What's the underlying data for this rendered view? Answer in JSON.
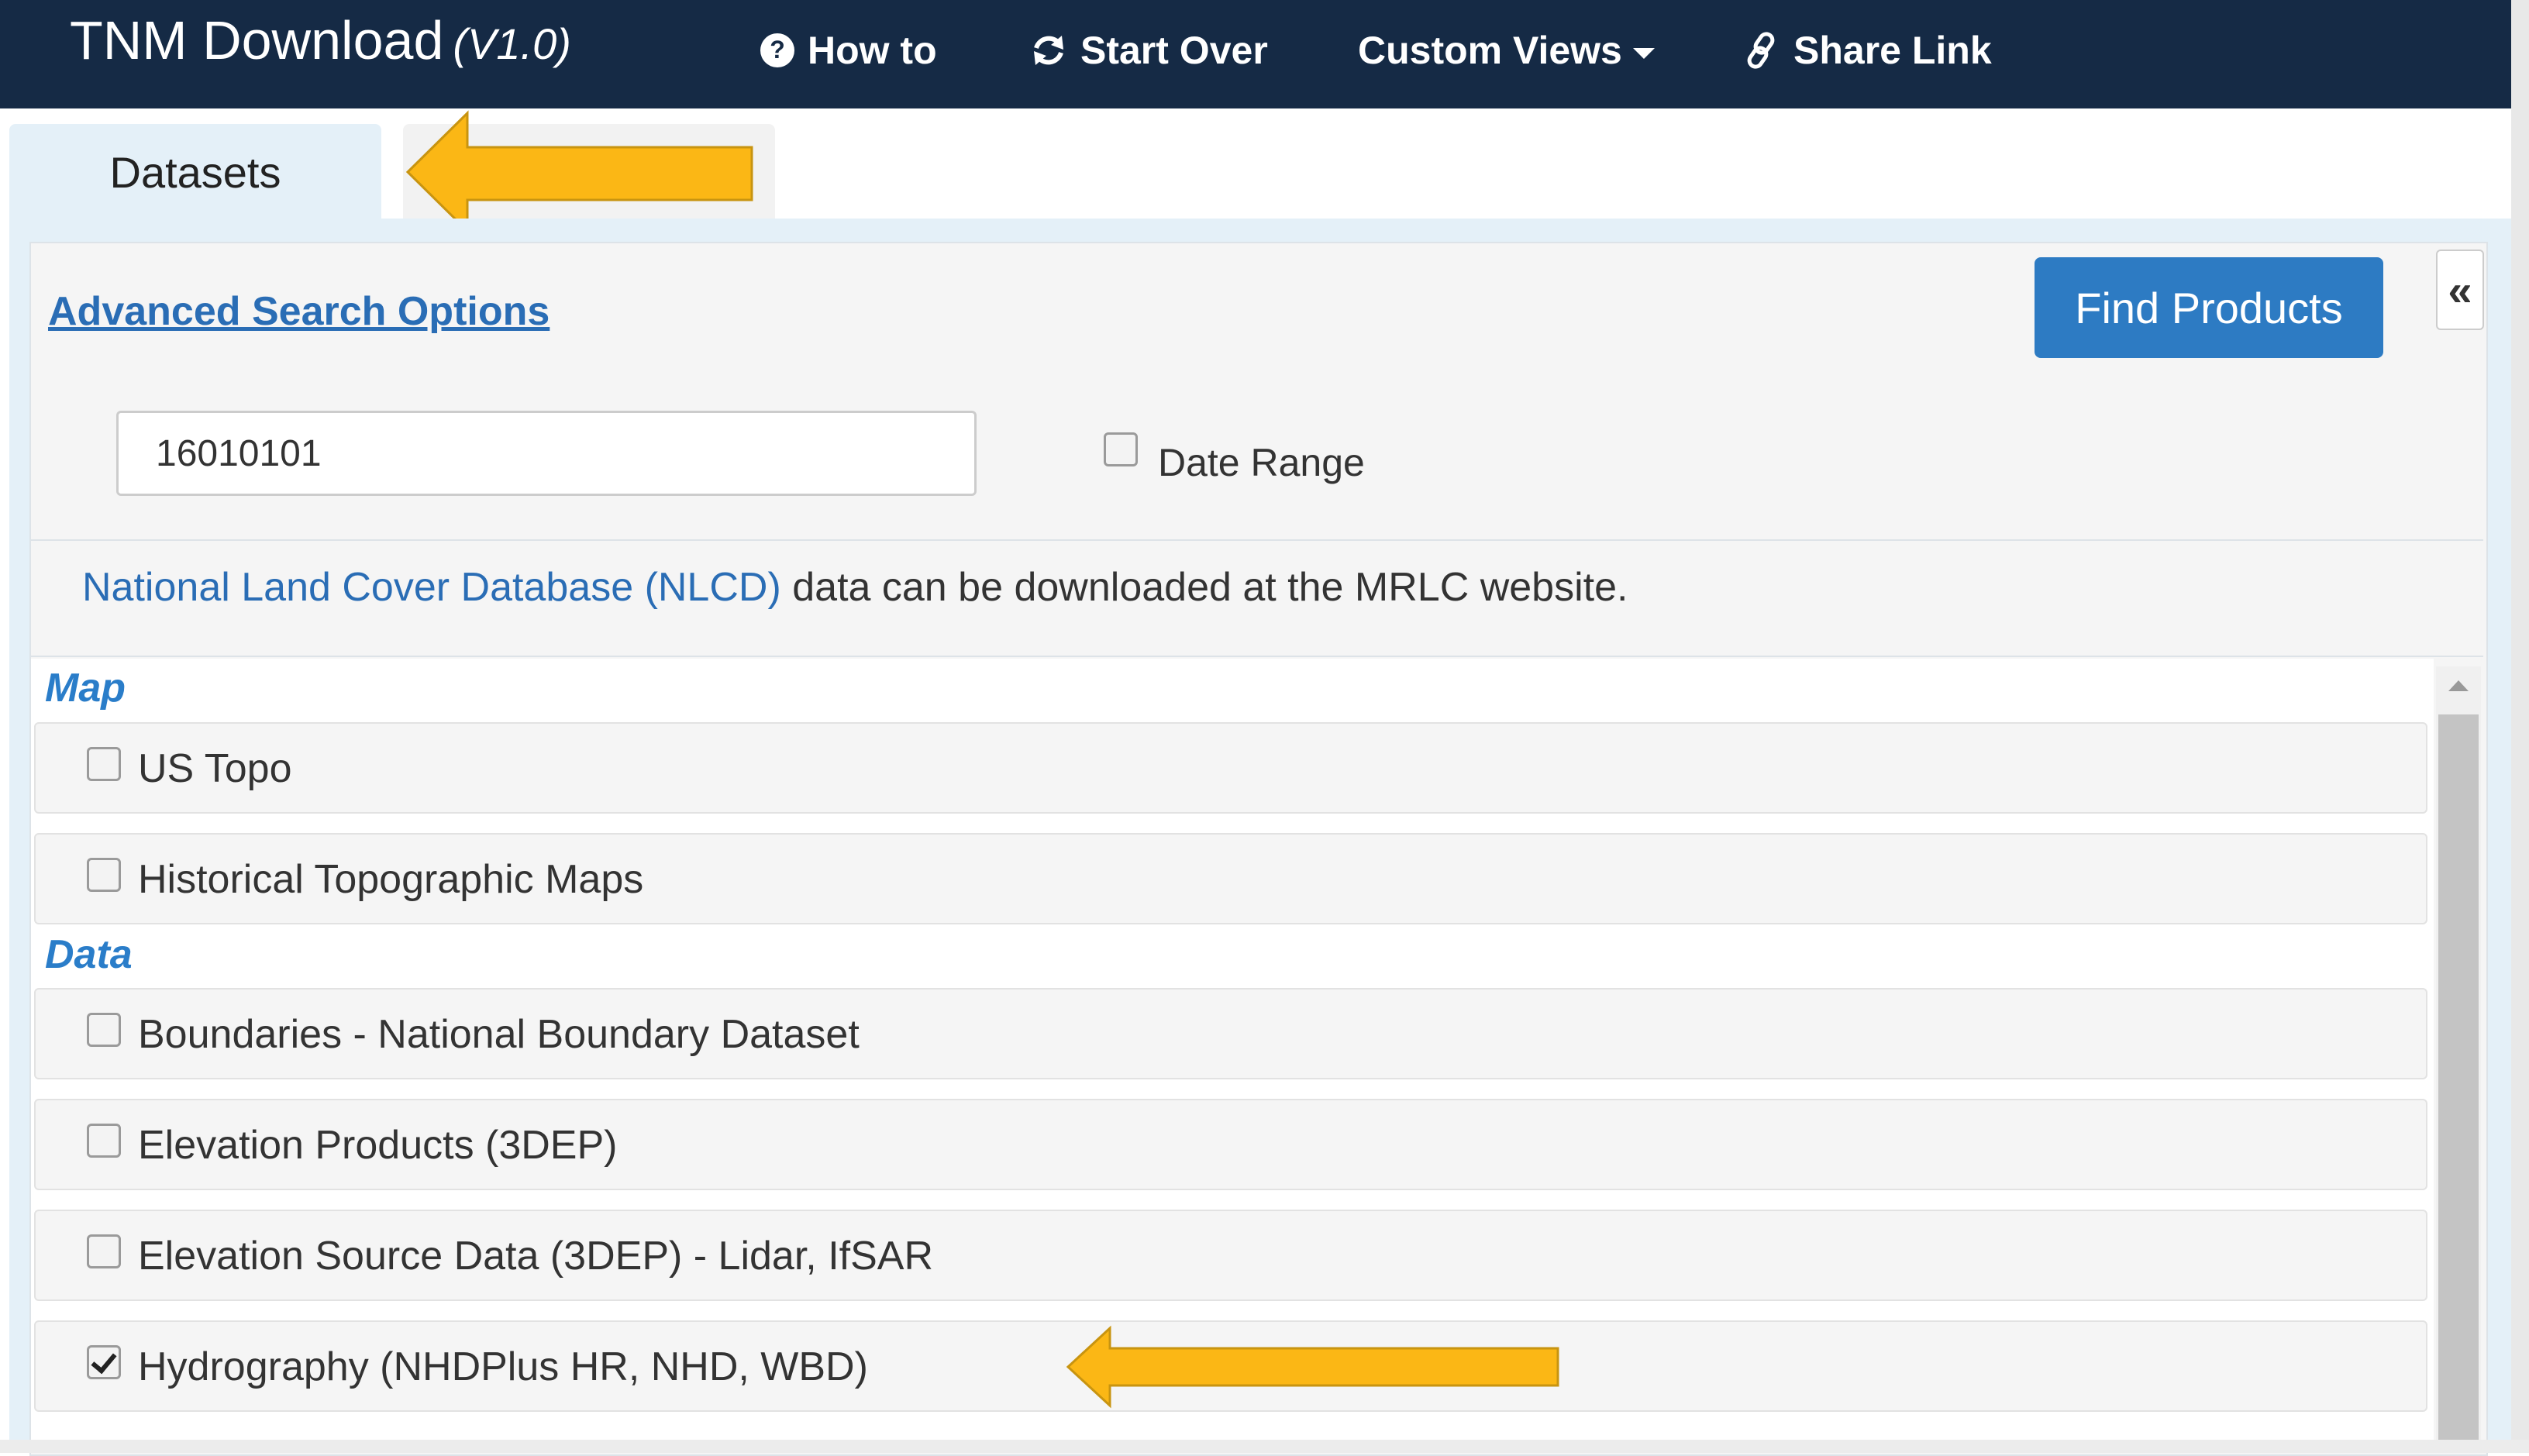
{
  "navbar": {
    "title": "TNM Download",
    "version": "(V1.0)",
    "items": [
      {
        "label": "How to",
        "icon": "question-circle-icon"
      },
      {
        "label": "Start Over",
        "icon": "refresh-icon"
      },
      {
        "label": "Custom Views",
        "icon": "chevron-down-icon"
      },
      {
        "label": "Share Link",
        "icon": "link-icon"
      }
    ]
  },
  "tabs": {
    "active_label": "Datasets"
  },
  "panel": {
    "advanced_link": "Advanced Search Options",
    "find_button": "Find Products",
    "collapse_glyph": "«",
    "search_value": "16010101",
    "date_range_label": "Date Range",
    "date_range_checked": false,
    "nlcd_link": "National Land Cover Database (NLCD)",
    "nlcd_text": " data can be downloaded at the MRLC website."
  },
  "sections": [
    {
      "heading": "Map",
      "items": [
        {
          "label": "US Topo",
          "checked": false
        },
        {
          "label": "Historical Topographic Maps",
          "checked": false
        }
      ]
    },
    {
      "heading": "Data",
      "items": [
        {
          "label": "Boundaries - National Boundary Dataset",
          "checked": false
        },
        {
          "label": "Elevation Products (3DEP)",
          "checked": false
        },
        {
          "label": "Elevation Source Data (3DEP) - Lidar, IfSAR",
          "checked": false
        },
        {
          "label": "Hydrography (NHDPlus HR, NHD, WBD)",
          "checked": true
        }
      ]
    }
  ],
  "colors": {
    "navbar_bg": "#152a45",
    "accent_blue": "#2d7bc3",
    "section_heading": "#2a7dc9",
    "annotation_arrow": "#fbb715"
  }
}
